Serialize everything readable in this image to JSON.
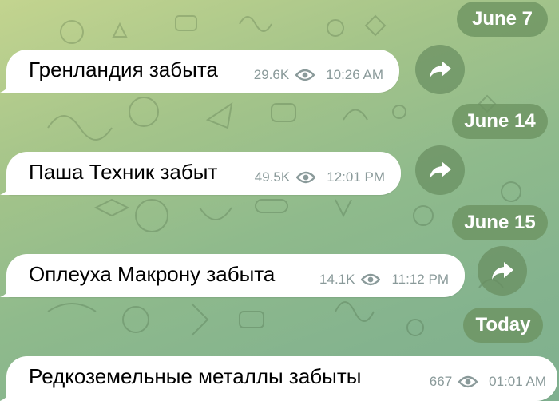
{
  "dates": [
    "June 7",
    "June 14",
    "June 15",
    "Today"
  ],
  "messages": [
    {
      "text": "Гренландия забыта",
      "views": "29.6K",
      "time": "10:26 AM"
    },
    {
      "text": "Паша Техник забыт",
      "views": "49.5K",
      "time": "12:01 PM"
    },
    {
      "text": "Оплеуха Макрону забыта",
      "views": "14.1K",
      "time": "11:12 PM"
    },
    {
      "text": "Редкоземельные металлы забыты",
      "views": "667",
      "time": "01:01 AM"
    }
  ],
  "icons": {
    "views": "eye-icon",
    "forward": "share-forward-icon"
  },
  "colors": {
    "background_top": "#c3d48f",
    "background_bottom": "#7fb08f",
    "pill": "#6c9260",
    "bubble": "#ffffff",
    "meta_text": "#8a9a9a"
  }
}
